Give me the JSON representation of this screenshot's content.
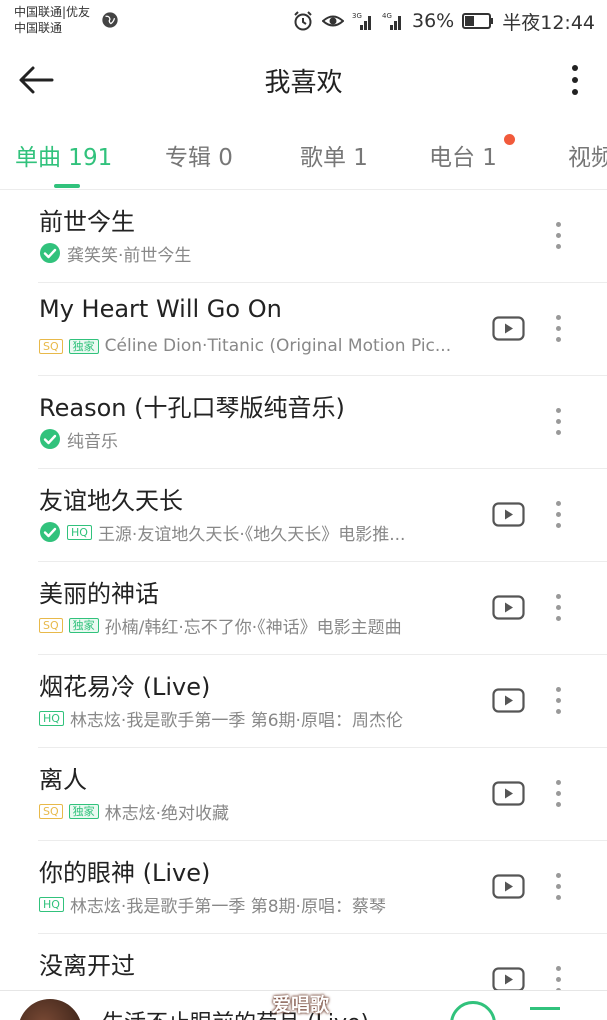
{
  "status_bar": {
    "carrier_line1": "中国联通|优友",
    "carrier_line2": "中国联通",
    "battery": "36%",
    "time": "半夜12:44"
  },
  "header": {
    "title": "我喜欢"
  },
  "tabs": [
    {
      "label": "单曲 191",
      "active": true
    },
    {
      "label": "专辑 0",
      "active": false
    },
    {
      "label": "歌单 1",
      "active": false
    },
    {
      "label": "电台 1",
      "active": false,
      "has_dot": true
    },
    {
      "label": "视频",
      "active": false
    }
  ],
  "badges": {
    "sq": "SQ",
    "hq": "HQ",
    "exclusive": "独家"
  },
  "songs": [
    {
      "title": "前世今生",
      "downloaded": true,
      "badges": [],
      "subtitle": "龚笑笑·前世今生",
      "has_mv": false
    },
    {
      "title": "My Heart Will Go On",
      "downloaded": false,
      "badges": [
        "sq",
        "exclusive"
      ],
      "subtitle": "Céline Dion·Titanic (Original Motion Pic...",
      "has_mv": true
    },
    {
      "title": "Reason (十孔口琴版纯音乐)",
      "downloaded": true,
      "badges": [],
      "subtitle": "纯音乐",
      "has_mv": false
    },
    {
      "title": "友谊地久天长",
      "downloaded": true,
      "badges": [
        "hq"
      ],
      "subtitle": "王源·友谊地久天长·《地久天长》电影推...",
      "has_mv": true
    },
    {
      "title": "美丽的神话",
      "downloaded": false,
      "badges": [
        "sq",
        "exclusive"
      ],
      "subtitle": "孙楠/韩红·忘不了你·《神话》电影主题曲",
      "has_mv": true
    },
    {
      "title": "烟花易冷 (Live)",
      "downloaded": false,
      "badges": [
        "hq"
      ],
      "subtitle": "林志炫·我是歌手第一季 第6期·原唱：周杰伦",
      "has_mv": true
    },
    {
      "title": "离人",
      "downloaded": false,
      "badges": [
        "sq",
        "exclusive"
      ],
      "subtitle": "林志炫·绝对收藏",
      "has_mv": true
    },
    {
      "title": "你的眼神 (Live)",
      "downloaded": false,
      "badges": [
        "hq"
      ],
      "subtitle": "林志炫·我是歌手第一季 第8期·原唱：蔡琴",
      "has_mv": true
    },
    {
      "title": "没离开过",
      "downloaded": false,
      "badges": [],
      "subtitle": "",
      "has_mv": true
    }
  ],
  "player": {
    "now_playing": "生活不止眼前的苟且 (Live)"
  },
  "watermark": "爱唱歌",
  "colors": {
    "accent": "#31c27c",
    "sq_badge": "#e8b94a",
    "notification_dot": "#f15a3b"
  }
}
